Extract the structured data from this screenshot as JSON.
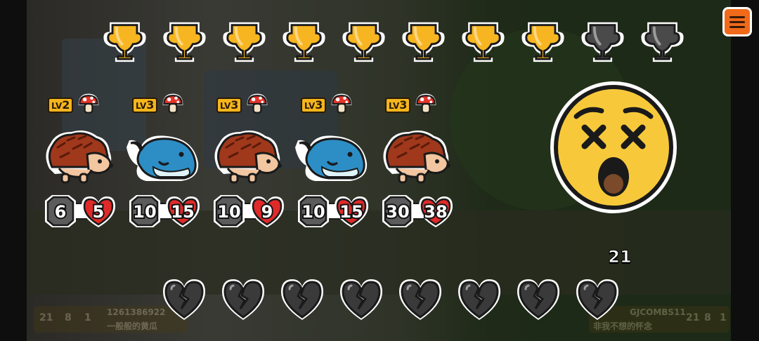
{
  "trophies": [
    {
      "state": "won"
    },
    {
      "state": "won"
    },
    {
      "state": "won"
    },
    {
      "state": "won"
    },
    {
      "state": "won"
    },
    {
      "state": "won"
    },
    {
      "state": "won"
    },
    {
      "state": "won"
    },
    {
      "state": "empty"
    },
    {
      "state": "empty"
    }
  ],
  "units": [
    {
      "animal": "hedgehog",
      "level_prefix": "LV",
      "level": "2",
      "attack": "6",
      "health": "5",
      "perk": "mushroom-icon"
    },
    {
      "animal": "whale",
      "level_prefix": "LV",
      "level": "3",
      "attack": "10",
      "health": "15",
      "perk": "mushroom-icon"
    },
    {
      "animal": "hedgehog",
      "level_prefix": "LV",
      "level": "3",
      "attack": "10",
      "health": "9",
      "perk": "mushroom-icon"
    },
    {
      "animal": "whale",
      "level_prefix": "LV",
      "level": "3",
      "attack": "10",
      "health": "15",
      "perk": "mushroom-icon"
    },
    {
      "animal": "hedgehog",
      "level_prefix": "LV",
      "level": "3",
      "attack": "30",
      "health": "38",
      "perk": "mushroom-icon"
    }
  ],
  "result": {
    "emoji": "dizzy-face-icon",
    "counter": "21"
  },
  "lives": {
    "broken_hearts": 8
  },
  "footer": {
    "left_turn": "21",
    "left_trophies": "8",
    "left_lives": "1",
    "left_id": "1261386922",
    "left_name": "一般般的黄瓜",
    "right_id": "GJCOMBS11",
    "right_turn": "21",
    "right_trophies": "8",
    "right_lives": "1",
    "right_name": "非我不想的怀念"
  },
  "colors": {
    "trophy_gold": "#f7b621",
    "trophy_empty": "#4a4a4a",
    "accent_orange": "#f06a1a",
    "attack_gray": "#5c5c5c",
    "health_red": "#e02a2a"
  },
  "menu": {
    "icon": "hamburger-menu-icon"
  }
}
